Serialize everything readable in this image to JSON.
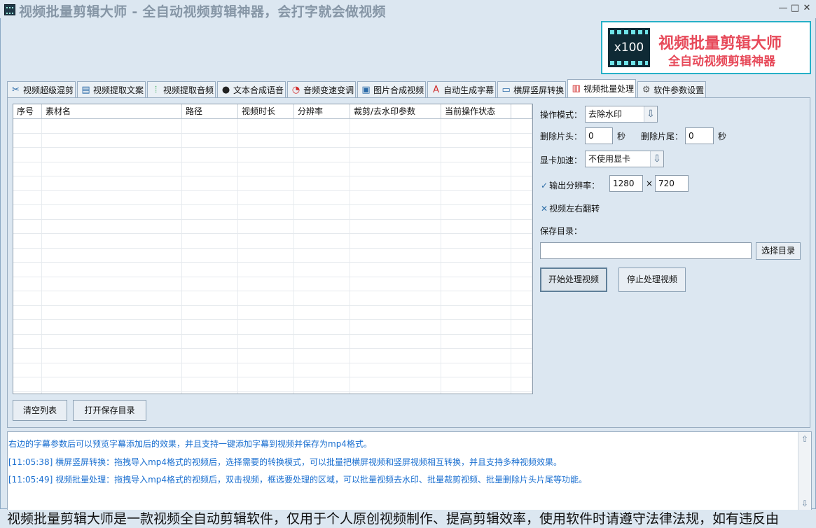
{
  "window": {
    "title": "视频批量剪辑大师 - 全自动视频剪辑神器，会打字就会做视频",
    "minimize_glyph": "—",
    "maximize_glyph": "□",
    "close_glyph": "✕"
  },
  "logo": {
    "badge": "x100",
    "line1": "视频批量剪辑大师",
    "line2": "全自动视频剪辑神器"
  },
  "tabs": [
    {
      "label": "视频超级混剪",
      "icon": "scissors-icon"
    },
    {
      "label": "视频提取文案",
      "icon": "document-icon"
    },
    {
      "label": "视频提取音频",
      "icon": "waveform-icon"
    },
    {
      "label": "文本合成语音",
      "icon": "microphone-icon"
    },
    {
      "label": "音频变速变调",
      "icon": "gauge-icon"
    },
    {
      "label": "图片合成视频",
      "icon": "image-icon"
    },
    {
      "label": "自动生成字幕",
      "icon": "font-icon"
    },
    {
      "label": "横屏竖屏转换",
      "icon": "rotate-screen-icon"
    },
    {
      "label": "视频批量处理",
      "icon": "film-icon",
      "active": true
    },
    {
      "label": "软件参数设置",
      "icon": "gear-icon"
    }
  ],
  "table": {
    "columns": [
      "序号",
      "素材名",
      "路径",
      "视频时长",
      "分辨率",
      "裁剪/去水印参数",
      "当前操作状态"
    ]
  },
  "buttons": {
    "clear_list": "清空列表",
    "open_save_dir": "打开保存目录",
    "choose_dir": "选择目录",
    "start": "开始处理视频",
    "stop": "停止处理视频"
  },
  "form": {
    "mode_label": "操作模式：",
    "mode_value": "去除水印",
    "cut_head_label": "删除片头：",
    "cut_head_value": "0",
    "sec1": "秒",
    "cut_tail_label": "删除片尾：",
    "cut_tail_value": "0",
    "sec2": "秒",
    "gpu_label": "显卡加速：",
    "gpu_value": "不使用显卡",
    "resolution_label": "输出分辨率：",
    "resolution_checked": true,
    "res_w": "1280",
    "res_x": "×",
    "res_h": "720",
    "flip_label": "视频左右翻转",
    "flip_checked": false,
    "save_dir_label": "保存目录：",
    "save_dir_value": ""
  },
  "log": [
    "右边的字幕参数后可以预览字幕添加后的效果，并且支持一键添加字幕到视频并保存为mp4格式。",
    "[11:05:38] 横屏竖屏转换：拖拽导入mp4格式的视频后，选择需要的转换模式，可以批量把横屏视频和竖屏视频相互转换，并且支持多种视频效果。",
    "[11:05:49] 视频批量处理：拖拽导入mp4格式的视频后，双击视频，框选要处理的区域，可以批量视频去水印、批量裁剪视频、批量删除片头片尾等功能。"
  ],
  "marquee": "视频批量剪辑大师是一款视频全自动剪辑软件，仅用于个人原创视频制作、提高剪辑效率，使用软件时请遵守法律法规，如有违反由"
}
